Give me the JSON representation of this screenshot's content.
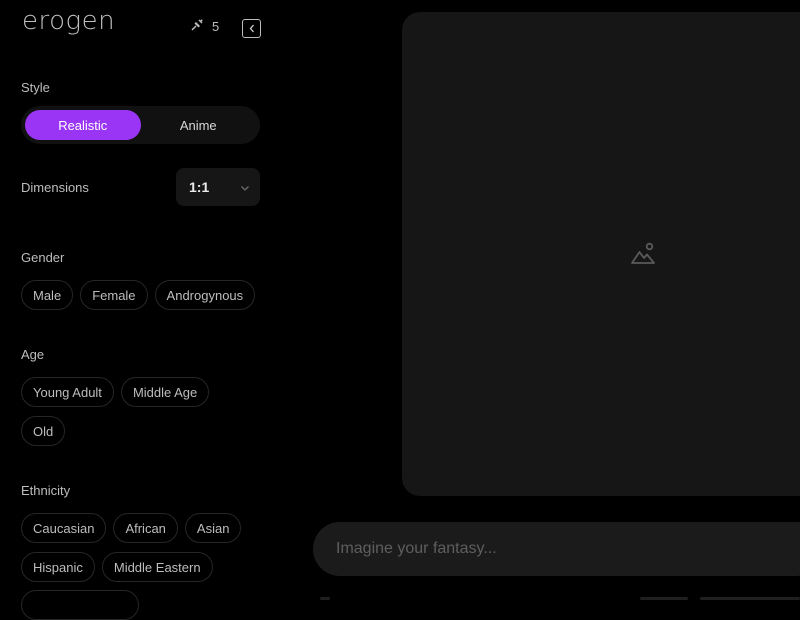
{
  "app": {
    "logo": "erogen"
  },
  "header": {
    "credits": "5",
    "credits_icon": "sparkle-pin-icon",
    "collapse_icon": "chevron-left-icon"
  },
  "style": {
    "label": "Style",
    "options": [
      "Realistic",
      "Anime"
    ],
    "selected": "Realistic"
  },
  "dimensions": {
    "label": "Dimensions",
    "value": "1:1",
    "icon": "chevron-down-icon"
  },
  "gender": {
    "label": "Gender",
    "options": [
      "Male",
      "Female",
      "Androgynous"
    ]
  },
  "age": {
    "label": "Age",
    "options": [
      "Young Adult",
      "Middle Age",
      "Old"
    ]
  },
  "ethnicity": {
    "label": "Ethnicity",
    "options": [
      "Caucasian",
      "African",
      "Asian",
      "Hispanic",
      "Middle Eastern"
    ]
  },
  "preview": {
    "icon": "image-placeholder-icon"
  },
  "prompt": {
    "placeholder": "Imagine your fantasy..."
  },
  "colors": {
    "accent": "#9b35f5",
    "background": "#000000",
    "panel": "#161616"
  }
}
